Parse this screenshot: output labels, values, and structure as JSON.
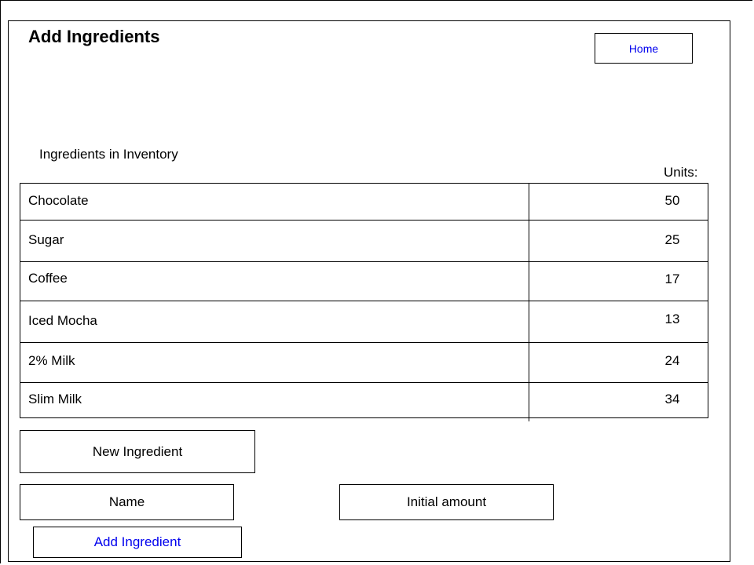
{
  "page": {
    "title": "Add Ingredients"
  },
  "nav": {
    "home_label": "Home"
  },
  "inventory": {
    "section_label": "Ingredients in Inventory",
    "units_header": "Units:",
    "rows": [
      {
        "name": "Chocolate",
        "units": "50"
      },
      {
        "name": "Sugar",
        "units": "25"
      },
      {
        "name": "Coffee",
        "units": "17"
      },
      {
        "name": "Iced Mocha",
        "units": "13"
      },
      {
        "name": "2% Milk",
        "units": "24"
      },
      {
        "name": "Slim Milk",
        "units": "34"
      }
    ]
  },
  "form": {
    "new_ingredient_label": "New Ingredient",
    "name_placeholder": "Name",
    "amount_placeholder": "Initial amount",
    "submit_label": "Add Ingredient"
  },
  "colors": {
    "link": "#0000ee",
    "border": "#000000"
  }
}
